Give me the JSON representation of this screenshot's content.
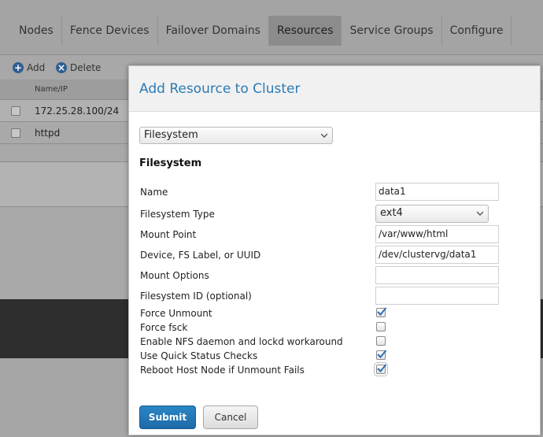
{
  "nav": {
    "tabs": [
      {
        "label": "Nodes"
      },
      {
        "label": "Fence Devices"
      },
      {
        "label": "Failover Domains"
      },
      {
        "label": "Resources"
      },
      {
        "label": "Service Groups"
      },
      {
        "label": "Configure"
      }
    ],
    "active_tab": "Resources"
  },
  "toolbar": {
    "add_label": "Add",
    "delete_label": "Delete"
  },
  "resources_table": {
    "column_header": "Name/IP",
    "rows": [
      {
        "name": "172.25.28.100/24"
      },
      {
        "name": "httpd"
      }
    ]
  },
  "dialog": {
    "title": "Add Resource to Cluster",
    "resource_type": "Filesystem",
    "section_title": "Filesystem",
    "fields": {
      "name": {
        "label": "Name",
        "value": "data1"
      },
      "fs_type": {
        "label": "Filesystem Type",
        "value": "ext4"
      },
      "mount_point": {
        "label": "Mount Point",
        "value": "/var/www/html"
      },
      "device": {
        "label": "Device, FS Label, or UUID",
        "value": "/dev/clustervg/data1"
      },
      "mount_options": {
        "label": "Mount Options",
        "value": ""
      },
      "fs_id": {
        "label": "Filesystem ID (optional)",
        "value": ""
      }
    },
    "checkboxes": {
      "force_unmount": {
        "label": "Force Unmount",
        "checked": true
      },
      "force_fsck": {
        "label": "Force fsck",
        "checked": false
      },
      "nfs_workaround": {
        "label": "Enable NFS daemon and lockd workaround",
        "checked": false
      },
      "quick_status": {
        "label": "Use Quick Status Checks",
        "checked": true
      },
      "reboot_on_fail": {
        "label": "Reboot Host Node if Unmount Fails",
        "checked": true
      }
    },
    "submit_label": "Submit",
    "cancel_label": "Cancel"
  },
  "colors": {
    "accent": "#2a7bb5",
    "primary_button": "#1e6aa8",
    "check_mark": "#2f6fb5"
  }
}
